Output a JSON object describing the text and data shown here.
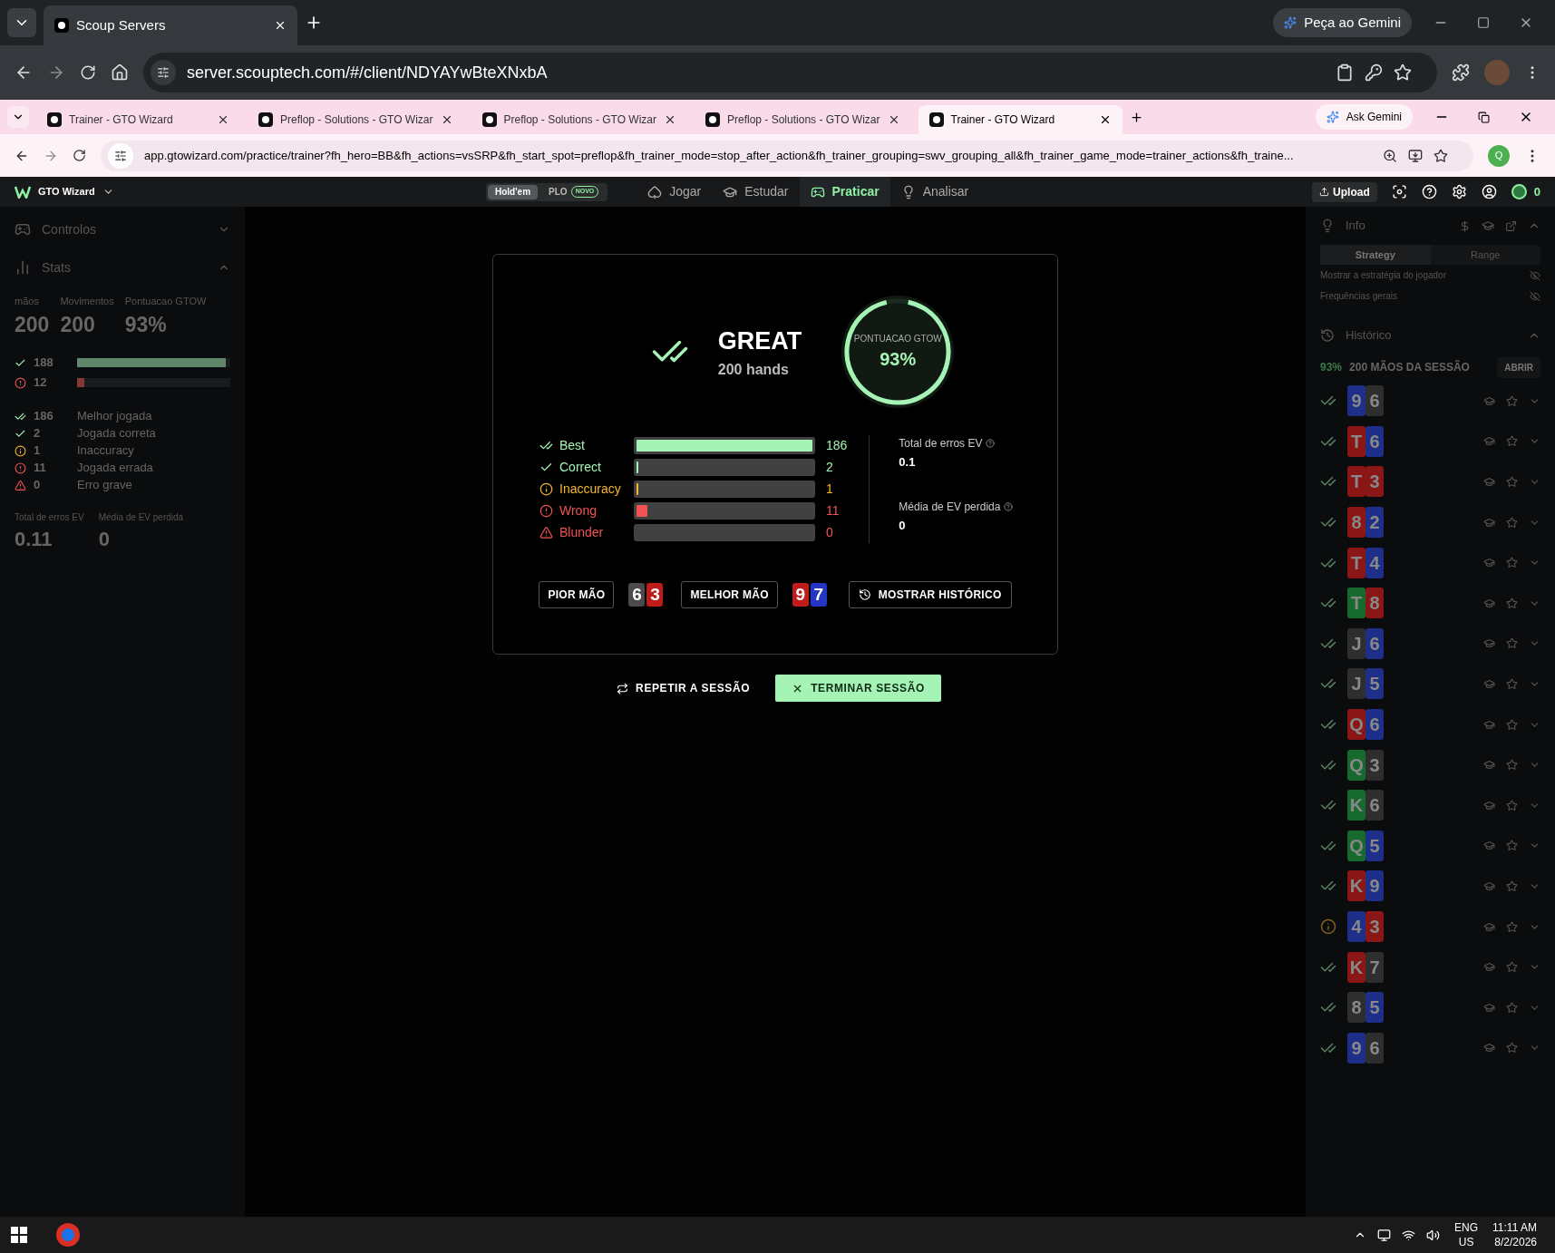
{
  "outer_browser": {
    "tabs": [
      {
        "title": "Scoup Servers",
        "selected": true
      }
    ],
    "url": "server.scouptech.com/#/client/NDYAYwBteXNxbA",
    "gemini": "Peça ao Gemini"
  },
  "inner_browser": {
    "tabs": [
      {
        "title": "Trainer - GTO Wizard",
        "selected": false
      },
      {
        "title": "Preflop - Solutions - GTO Wizar",
        "selected": false
      },
      {
        "title": "Preflop - Solutions - GTO Wizar",
        "selected": false
      },
      {
        "title": "Preflop - Solutions - GTO Wizar",
        "selected": false
      },
      {
        "title": "Trainer - GTO Wizard",
        "selected": true
      }
    ],
    "url": "app.gtowizard.com/practice/trainer?fh_hero=BB&fh_actions=vsSRP&fh_start_spot=preflop&fh_trainer_mode=stop_after_action&fh_trainer_grouping=swv_grouping_all&fh_trainer_game_mode=trainer_actions&fh_traine...",
    "gemini": "Ask Gemini",
    "profile": "Q"
  },
  "app_nav": {
    "brand": "GTO Wizard",
    "games": [
      {
        "label": "Hold'em",
        "selected": true
      },
      {
        "label": "PLO",
        "badge": "NOVO",
        "selected": false
      }
    ],
    "items": [
      {
        "kind": "play",
        "label": "Jogar",
        "selected": false
      },
      {
        "kind": "study",
        "label": "Estudar",
        "selected": false
      },
      {
        "kind": "practice",
        "label": "Praticar",
        "selected": true
      },
      {
        "kind": "analyze",
        "label": "Analisar",
        "selected": false
      }
    ],
    "upload": "Upload",
    "coins": "0"
  },
  "left_panel": {
    "controls": "Controlos",
    "stats": "Stats",
    "headline": [
      {
        "label": "mãos",
        "value": "200"
      },
      {
        "label": "Movimentos",
        "value": "200"
      },
      {
        "label": "Pontuacao GTOW",
        "value": "93%"
      }
    ],
    "summary": [
      {
        "kind": "correct",
        "count": "188",
        "level": 0.97
      },
      {
        "kind": "wrong",
        "count": "12",
        "level": 0.05
      }
    ],
    "breakdown": [
      {
        "kind": "best",
        "count": "186",
        "label": "Melhor jogada"
      },
      {
        "kind": "correct",
        "count": "2",
        "label": "Jogada correta"
      },
      {
        "kind": "inaccuracy",
        "count": "1",
        "label": "Inaccuracy"
      },
      {
        "kind": "wrong",
        "count": "11",
        "label": "Jogada errada"
      },
      {
        "kind": "blunder",
        "count": "0",
        "label": "Erro grave"
      }
    ],
    "ev": [
      {
        "label": "Total de erros EV",
        "value": "0.11"
      },
      {
        "label": "Média de EV perdida",
        "value": "0"
      }
    ]
  },
  "result_card": {
    "title": "GREAT",
    "subtitle": "200 hands",
    "score_label": "PONTUACAO GTOW",
    "score": "93%",
    "level": 0.93,
    "rows": [
      {
        "kind": "best",
        "label": "Best",
        "count": "186",
        "level": 1
      },
      {
        "kind": "correct",
        "label": "Correct",
        "count": "2",
        "level": 0.01
      },
      {
        "kind": "inaccuracy",
        "label": "Inaccuracy",
        "count": "1",
        "level": 0.006
      },
      {
        "kind": "wrong",
        "label": "Wrong",
        "count": "11",
        "level": 0.06
      },
      {
        "kind": "blunder",
        "label": "Blunder",
        "count": "0",
        "level": 0
      }
    ],
    "ev": [
      {
        "label": "Total de erros EV",
        "value": "0.1"
      },
      {
        "label": "Média de EV perdida",
        "value": "0"
      }
    ],
    "hands": [
      {
        "label": "PIOR MÃO",
        "cards": [
          {
            "rank": "6",
            "color": "#4b4b4b"
          },
          {
            "rank": "3",
            "color": "#c01c1c"
          }
        ]
      },
      {
        "label": "MELHOR MÃO",
        "cards": [
          {
            "rank": "9",
            "color": "#c01c1c"
          },
          {
            "rank": "7",
            "color": "#2536c4"
          }
        ]
      }
    ],
    "history_button": "MOSTRAR HISTÓRICO"
  },
  "actions": [
    {
      "kind": "repeat",
      "label": "REPETIR A SESSÃO"
    },
    {
      "kind": "finish",
      "label": "TERMINAR SESSÃO"
    }
  ],
  "right_panel": {
    "info": "Info",
    "tabs": [
      {
        "label": "Strategy",
        "selected": true
      },
      {
        "label": "Range",
        "selected": false
      }
    ],
    "toggles": [
      "Mostrar a estratégia do jogador",
      "Frequências gerais"
    ],
    "history": "Histórico",
    "session_score": "93%",
    "session_label": "200 MÃOS DA SESSÃO",
    "open": "ABRIR",
    "hands": [
      {
        "kind": "best",
        "cards": [
          {
            "rank": "9",
            "color": "#1e2f8a"
          },
          {
            "rank": "6",
            "color": "#2e2e2e"
          }
        ]
      },
      {
        "kind": "best",
        "cards": [
          {
            "rank": "T",
            "color": "#8a1616"
          },
          {
            "rank": "6",
            "color": "#1e2f8a"
          }
        ]
      },
      {
        "kind": "best",
        "cards": [
          {
            "rank": "T",
            "color": "#8a1616"
          },
          {
            "rank": "3",
            "color": "#8a1616"
          }
        ]
      },
      {
        "kind": "best",
        "cards": [
          {
            "rank": "8",
            "color": "#8a1616"
          },
          {
            "rank": "2",
            "color": "#1e2f8a"
          }
        ]
      },
      {
        "kind": "best",
        "cards": [
          {
            "rank": "T",
            "color": "#8a1616"
          },
          {
            "rank": "4",
            "color": "#1e2f8a"
          }
        ]
      },
      {
        "kind": "best",
        "cards": [
          {
            "rank": "T",
            "color": "#166a2e"
          },
          {
            "rank": "8",
            "color": "#8a1616"
          }
        ]
      },
      {
        "kind": "best",
        "cards": [
          {
            "rank": "J",
            "color": "#2e2e2e"
          },
          {
            "rank": "6",
            "color": "#1e2f8a"
          }
        ]
      },
      {
        "kind": "best",
        "cards": [
          {
            "rank": "J",
            "color": "#2e2e2e"
          },
          {
            "rank": "5",
            "color": "#1e2f8a"
          }
        ]
      },
      {
        "kind": "best",
        "cards": [
          {
            "rank": "Q",
            "color": "#8a1616"
          },
          {
            "rank": "6",
            "color": "#1e2f8a"
          }
        ]
      },
      {
        "kind": "best",
        "cards": [
          {
            "rank": "Q",
            "color": "#166a2e"
          },
          {
            "rank": "3",
            "color": "#2e2e2e"
          }
        ]
      },
      {
        "kind": "best",
        "cards": [
          {
            "rank": "K",
            "color": "#166a2e"
          },
          {
            "rank": "6",
            "color": "#2e2e2e"
          }
        ]
      },
      {
        "kind": "best",
        "cards": [
          {
            "rank": "Q",
            "color": "#166a2e"
          },
          {
            "rank": "5",
            "color": "#1e2f8a"
          }
        ]
      },
      {
        "kind": "best",
        "cards": [
          {
            "rank": "K",
            "color": "#8a1616"
          },
          {
            "rank": "9",
            "color": "#1e2f8a"
          }
        ]
      },
      {
        "kind": "inaccuracy",
        "cards": [
          {
            "rank": "4",
            "color": "#1e2f8a"
          },
          {
            "rank": "3",
            "color": "#8a1616"
          }
        ]
      },
      {
        "kind": "best",
        "cards": [
          {
            "rank": "K",
            "color": "#8a1616"
          },
          {
            "rank": "7",
            "color": "#2e2e2e"
          }
        ]
      },
      {
        "kind": "best",
        "cards": [
          {
            "rank": "8",
            "color": "#2e2e2e"
          },
          {
            "rank": "5",
            "color": "#1e2f8a"
          }
        ]
      },
      {
        "kind": "best",
        "cards": [
          {
            "rank": "9",
            "color": "#1e2f8a"
          },
          {
            "rank": "6",
            "color": "#2e2e2e"
          }
        ]
      }
    ]
  },
  "taskbar": {
    "lang": "ENG",
    "region": "US",
    "time": "11:11 AM",
    "date": "8/2/2026"
  }
}
